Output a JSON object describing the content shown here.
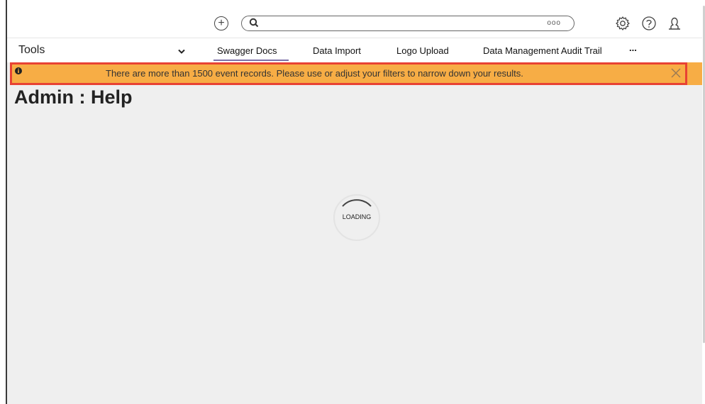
{
  "header": {
    "search": {
      "placeholder": "",
      "options_label": "ooo"
    },
    "icons": {
      "add": "plus-circle-icon",
      "search": "search-icon",
      "settings": "gear-icon",
      "help": "help-icon",
      "user": "user-icon"
    }
  },
  "tools": {
    "label": "Tools",
    "tabs": [
      {
        "label": "Swagger Docs",
        "active": true
      },
      {
        "label": "Data Import"
      },
      {
        "label": "Logo Upload"
      },
      {
        "label": "Data Management Audit Trail"
      },
      {
        "label": "..."
      }
    ]
  },
  "alert": {
    "message": "There are more than 1500 event records. Please use or adjust your filters to narrow down your results.",
    "bg_color": "#f7ad45",
    "highlight_color": "#e84233"
  },
  "page": {
    "title": "Admin : Help"
  },
  "loader": {
    "text": "LOADING"
  },
  "colors": {
    "tab_underline": "#7b6fa8",
    "content_bg": "#efefef"
  }
}
